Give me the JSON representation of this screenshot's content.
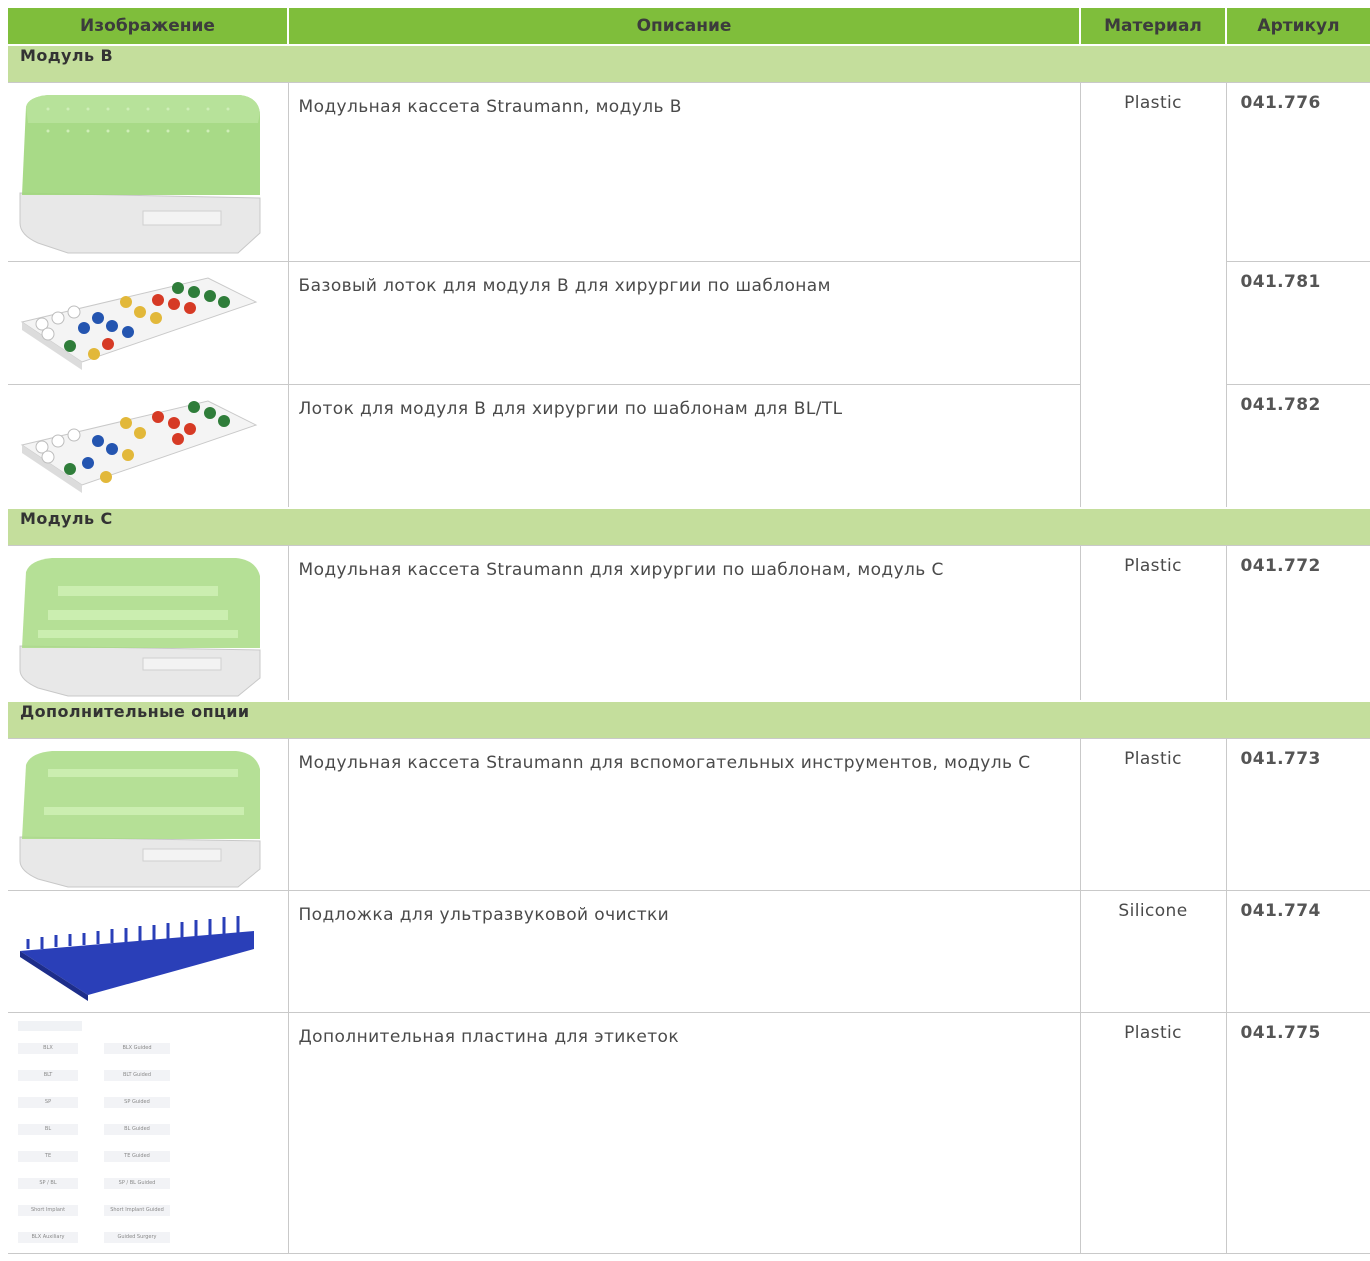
{
  "headers": {
    "image": "Изображение",
    "description": "Описание",
    "material": "Материал",
    "article": "Артикул"
  },
  "sections": [
    {
      "title": "Модуль B",
      "rows": [
        {
          "description": "Модульная кассета Straumann, модуль B",
          "material": "Plastic",
          "article": "041.776",
          "image": "green-lid-cassette-image"
        },
        {
          "description": "Базовый лоток для модуля B для хирургии по шаблонам",
          "material": "",
          "article": "041.781",
          "image": "color-tray-image"
        },
        {
          "description": "Лоток для модуля B для хирургии по шаблонам для BL/TL",
          "material": "",
          "article": "041.782",
          "image": "color-tray-image"
        }
      ]
    },
    {
      "title": "Модуль C",
      "rows": [
        {
          "description": "Модульная кассета Straumann для хирургии по шаблонам, модуль C",
          "material": "Plastic",
          "article": "041.772",
          "image": "green-lid-cassette-c-image"
        }
      ]
    },
    {
      "title": "Дополнительные опции",
      "rows": [
        {
          "description": "Модульная кассета Straumann для вспомогательных инструментов, модуль C",
          "material": "Plastic",
          "article": "041.773",
          "image": "green-lid-cassette-aux-image"
        },
        {
          "description": "Подложка для ультразвуковой очистки",
          "material": "Silicone",
          "article": "041.774",
          "image": "blue-silicone-mat-image"
        },
        {
          "description": "Дополнительная пластина для этикеток",
          "material": "Plastic",
          "article": "041.775",
          "image": "label-plate-image"
        }
      ]
    }
  ],
  "label_plate": [
    [
      "BLX",
      "BLX Guided"
    ],
    [
      "BLT",
      "BLT Guided"
    ],
    [
      "SP",
      "SP Guided"
    ],
    [
      "BL",
      "BL Guided"
    ],
    [
      "TE",
      "TE Guided"
    ],
    [
      "SP / BL",
      "SP / BL Guided"
    ],
    [
      "Short Implant",
      "Short Implant Guided"
    ],
    [
      "BLX Auxiliary",
      "Guided Surgery"
    ]
  ]
}
